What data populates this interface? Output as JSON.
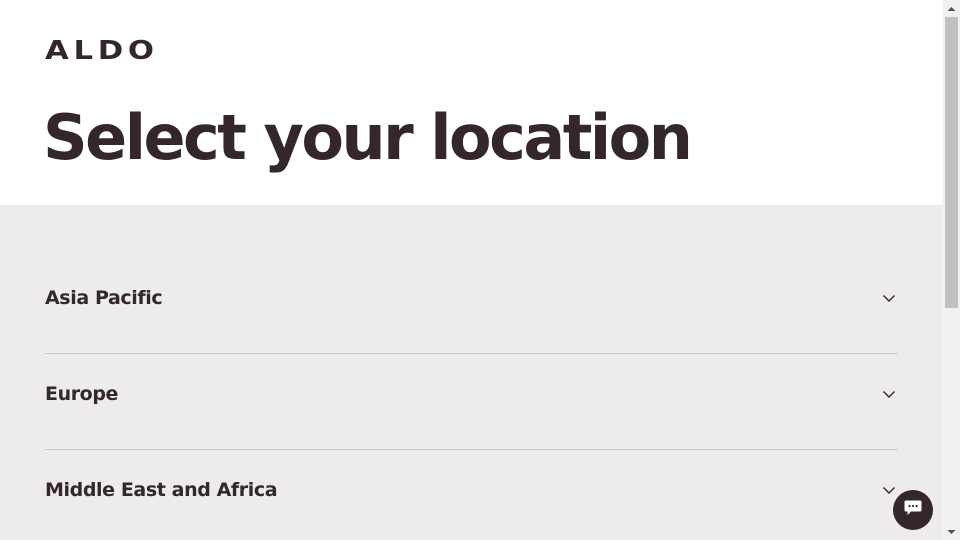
{
  "header": {
    "logo_text": "ALDO",
    "title": "Select your location"
  },
  "regions": [
    {
      "label": "Asia Pacific",
      "icon": "chevron-down-icon"
    },
    {
      "label": "Europe",
      "icon": "chevron-down-icon"
    },
    {
      "label": "Middle East and Africa",
      "icon": "chevron-down-icon"
    }
  ],
  "chat": {
    "icon": "chat-bubble-icon"
  },
  "colors": {
    "text": "#33272a",
    "region_background": "#edebed",
    "divider": "#cfcacc",
    "chat_button": "#33272a"
  }
}
